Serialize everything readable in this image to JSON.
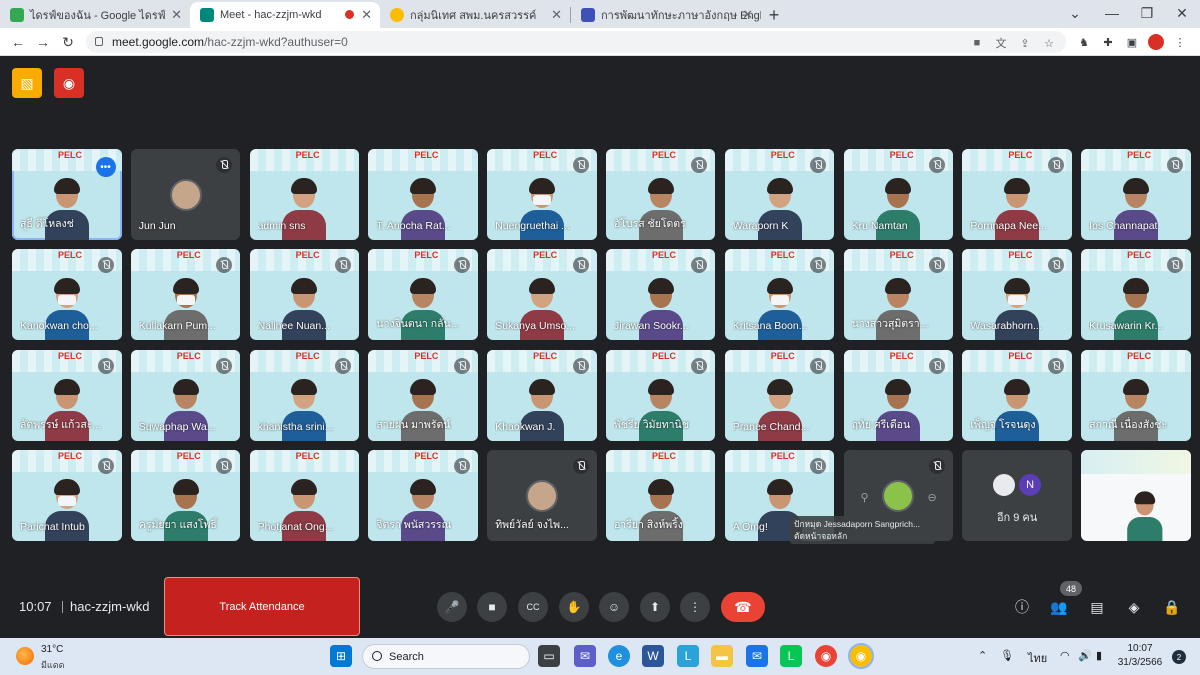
{
  "browser": {
    "tabs": [
      {
        "title": "ไดรฟ์ของฉัน - Google ไดรฟ์",
        "color": "#34a853"
      },
      {
        "title": "Meet - hac-zzjm-wkd",
        "color": "#00897b"
      },
      {
        "title": "กลุ่มนิเทศ สพม.นครสวรรค์",
        "color": "#fbbc04"
      },
      {
        "title": "การพัฒนาทักษะภาษาอังกฤษ English",
        "color": "#3f51b5"
      }
    ],
    "url_host": "meet.google.com",
    "url_path": "/hac-zzjm-wkd?authuser=0"
  },
  "icons": {
    "tab_close": "✕",
    "new_tab": "+",
    "minimize": "—",
    "restore": "❐",
    "close_window": "✕",
    "collapse": "⌄",
    "back": "←",
    "forward": "→",
    "reload": "↻",
    "mic": "🎤",
    "cam": "■",
    "cc": "CC",
    "hand": "✋",
    "emoji": "☺",
    "present": "⬆",
    "more": "⋮",
    "hangup": "☎",
    "info": "ⓘ",
    "people": "👥",
    "chat": "▤",
    "activities": "◈",
    "host": "🔒"
  },
  "meeting": {
    "tiles": [
      {
        "name": "สุธี ดีโหลงช่",
        "type": "video",
        "active": true,
        "muted": false,
        "mask": false
      },
      {
        "name": "Jun Jun",
        "type": "avatar",
        "muted": true
      },
      {
        "name": "admin sns",
        "type": "video",
        "muted": false,
        "mask": false
      },
      {
        "name": "T. Anocha Rat...",
        "type": "video",
        "muted": false,
        "mask": false
      },
      {
        "name": "Nuengruethai ...",
        "type": "video",
        "muted": true,
        "mask": true
      },
      {
        "name": "อัโบรส ชัยโดตร",
        "type": "video",
        "muted": true,
        "mask": false
      },
      {
        "name": "Waraporn K",
        "type": "video",
        "muted": true,
        "mask": false
      },
      {
        "name": "Kru Namtan",
        "type": "video",
        "muted": true,
        "mask": false
      },
      {
        "name": "Pornnapa Nee...",
        "type": "video",
        "muted": true,
        "mask": false
      },
      {
        "name": "Ios Channapat",
        "type": "video",
        "muted": true,
        "mask": false
      },
      {
        "name": "Kanokwan cho...",
        "type": "video",
        "muted": true,
        "mask": true
      },
      {
        "name": "Kullakarn Pum...",
        "type": "video",
        "muted": true,
        "mask": true
      },
      {
        "name": "Nalinee Nuan...",
        "type": "video",
        "muted": true,
        "mask": false
      },
      {
        "name": "นางจินตนา กลั่น...",
        "type": "video",
        "muted": true,
        "mask": false
      },
      {
        "name": "Sukanya Umso...",
        "type": "video",
        "muted": true,
        "mask": false
      },
      {
        "name": "Jirawan Sookr...",
        "type": "video",
        "muted": true,
        "mask": false
      },
      {
        "name": "Kritsana Boon...",
        "type": "video",
        "muted": true,
        "mask": true
      },
      {
        "name": "นางสาวสุมิตรา...",
        "type": "video",
        "muted": true,
        "mask": false
      },
      {
        "name": "Wasarabhorn...",
        "type": "video",
        "muted": true,
        "mask": true
      },
      {
        "name": "Krusawarin Kr...",
        "type": "video",
        "muted": true,
        "mask": false
      },
      {
        "name": "ลัดพรรษ์ แก้วสะ...",
        "type": "video",
        "muted": true,
        "mask": false
      },
      {
        "name": "Suwaphap Wa...",
        "type": "video",
        "muted": true,
        "mask": false
      },
      {
        "name": "khanistha srini...",
        "type": "video",
        "muted": true,
        "mask": false
      },
      {
        "name": "สายฝน มาพรัตน์",
        "type": "video",
        "muted": true,
        "mask": false
      },
      {
        "name": "Khaokwan J.",
        "type": "video",
        "muted": true,
        "mask": false
      },
      {
        "name": "พัชรีย วิมัยทานิช",
        "type": "video",
        "muted": true,
        "mask": false
      },
      {
        "name": "Pranee Chand...",
        "type": "video",
        "muted": true,
        "mask": false
      },
      {
        "name": "ฤทัย ศรีเดือน",
        "type": "video",
        "muted": true,
        "mask": false
      },
      {
        "name": "เพ็ญจ โรจนดุง",
        "type": "video",
        "muted": true,
        "mask": false
      },
      {
        "name": "สกาณี เนื่องสังชะ",
        "type": "video",
        "muted": false,
        "mask": false
      },
      {
        "name": "Parichat Intub",
        "type": "video",
        "muted": true,
        "mask": true
      },
      {
        "name": "ครูมัยยา แสงโพธิ์",
        "type": "video",
        "muted": true,
        "mask": false
      },
      {
        "name": "Photjanat Ong...",
        "type": "video",
        "muted": false,
        "mask": false
      },
      {
        "name": "จิตรา พนัสวรรณ",
        "type": "video",
        "muted": true,
        "mask": false
      },
      {
        "name": "ทิพย์วัลย์ จงไพ...",
        "type": "avatar",
        "muted": true
      },
      {
        "name": "อารียา สิงห์พริ้ง",
        "type": "video",
        "muted": false,
        "mask": false
      },
      {
        "name": "A Omg!",
        "type": "video",
        "muted": true,
        "mask": false
      },
      {
        "name": "",
        "type": "hovered",
        "muted": true
      },
      {
        "name": "อีก 9 คน",
        "type": "more",
        "more_initial": "N"
      },
      {
        "name": "",
        "type": "slide",
        "muted": false
      }
    ],
    "hover_caption": "ปักหมุด Jessadaporn Sangprich... ตัดหน้าจอหลัก",
    "time": "10:07",
    "code": "hac-zzjm-wkd",
    "track_attendance_label": "Track Attendance",
    "participant_count": "48"
  },
  "taskbar": {
    "temperature": "31°C",
    "condition": "มีแดด",
    "search_label": "Search",
    "language": "ไทย",
    "time": "10:07",
    "date": "31/3/2566",
    "notification_count": "2"
  }
}
